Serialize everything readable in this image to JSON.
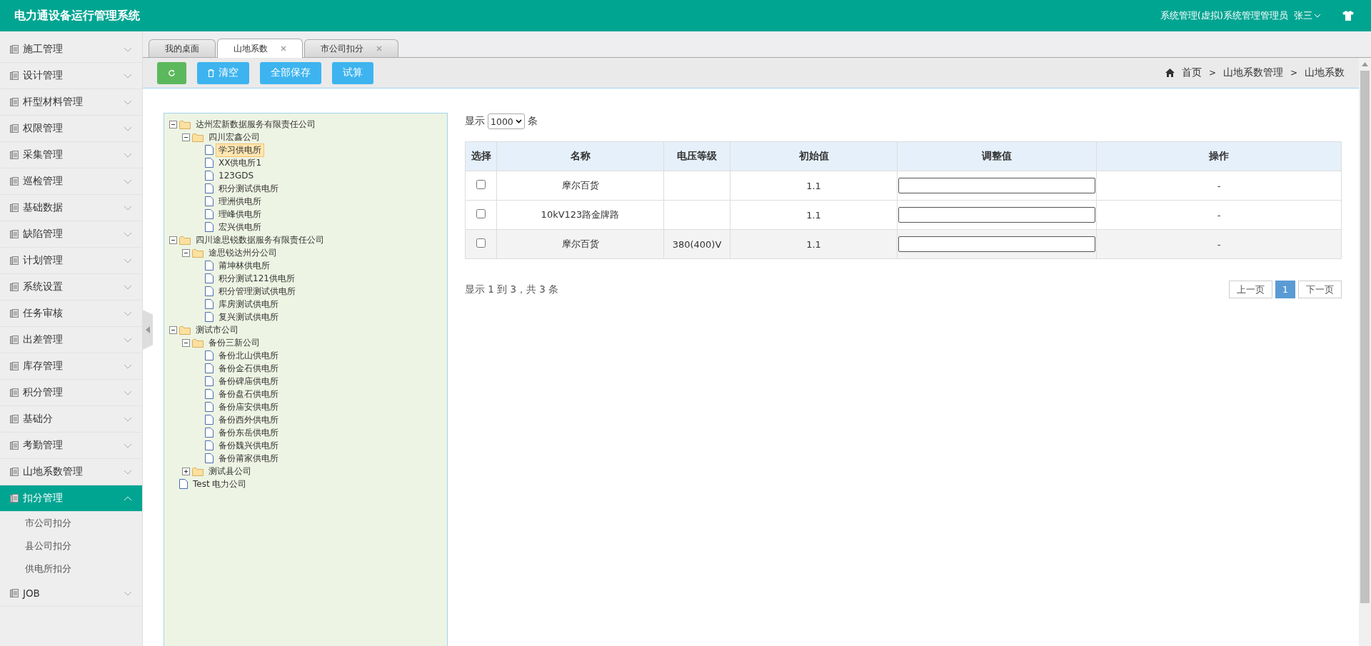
{
  "header": {
    "title": "电力通设备运行管理系统",
    "role": "系统管理(虚拟)系统管理管理员",
    "user": "张三"
  },
  "sidebar": {
    "items": [
      {
        "label": "施工管理",
        "expanded": false,
        "selected": false
      },
      {
        "label": "设计管理",
        "expanded": false,
        "selected": false
      },
      {
        "label": "杆型材料管理",
        "expanded": false,
        "selected": false
      },
      {
        "label": "权限管理",
        "expanded": false,
        "selected": false
      },
      {
        "label": "采集管理",
        "expanded": false,
        "selected": false
      },
      {
        "label": "巡检管理",
        "expanded": false,
        "selected": false
      },
      {
        "label": "基础数据",
        "expanded": false,
        "selected": false
      },
      {
        "label": "缺陷管理",
        "expanded": false,
        "selected": false
      },
      {
        "label": "计划管理",
        "expanded": false,
        "selected": false
      },
      {
        "label": "系统设置",
        "expanded": false,
        "selected": false
      },
      {
        "label": "任务审核",
        "expanded": false,
        "selected": false
      },
      {
        "label": "出差管理",
        "expanded": false,
        "selected": false
      },
      {
        "label": "库存管理",
        "expanded": false,
        "selected": false
      },
      {
        "label": "积分管理",
        "expanded": false,
        "selected": false
      },
      {
        "label": "基础分",
        "expanded": false,
        "selected": false
      },
      {
        "label": "考勤管理",
        "expanded": false,
        "selected": false
      },
      {
        "label": "山地系数管理",
        "expanded": false,
        "selected": false
      },
      {
        "label": "扣分管理",
        "expanded": true,
        "selected": true,
        "children": [
          "市公司扣分",
          "县公司扣分",
          "供电所扣分"
        ]
      },
      {
        "label": "JOB",
        "expanded": false,
        "selected": false
      }
    ]
  },
  "tabs": [
    {
      "label": "我的桌面",
      "selected": false,
      "closable": false
    },
    {
      "label": "山地系数",
      "selected": true,
      "closable": true
    },
    {
      "label": "市公司扣分",
      "selected": false,
      "closable": true
    }
  ],
  "toolbar": [
    {
      "kind": "refresh"
    },
    {
      "kind": "clear",
      "label": "清空"
    },
    {
      "kind": "text",
      "label": "全部保存"
    },
    {
      "kind": "text",
      "label": "试算"
    }
  ],
  "breadcrumb": {
    "items": [
      "首页",
      "山地系数管理",
      "山地系数"
    ],
    "separator": ">"
  },
  "tree": [
    {
      "label": "达州宏新数据服务有限责任公司",
      "kind": "folder",
      "expanded": true,
      "selected": false,
      "children": [
        {
          "label": "四川宏鑫公司",
          "kind": "folder",
          "expanded": true,
          "selected": false,
          "children": [
            {
              "label": "学习供电所",
              "kind": "file",
              "selected": true
            },
            {
              "label": "XX供电所1",
              "kind": "file",
              "selected": false
            },
            {
              "label": "123GDS",
              "kind": "file",
              "selected": false
            },
            {
              "label": "积分测试供电所",
              "kind": "file",
              "selected": false
            },
            {
              "label": "理洲供电所",
              "kind": "file",
              "selected": false
            },
            {
              "label": "理峰供电所",
              "kind": "file",
              "selected": false
            },
            {
              "label": "宏兴供电所",
              "kind": "file",
              "selected": false
            }
          ]
        }
      ]
    },
    {
      "label": "四川途思锐数据服务有限责任公司",
      "kind": "folder",
      "expanded": true,
      "selected": false,
      "children": [
        {
          "label": "途思锐达州分公司",
          "kind": "folder",
          "expanded": true,
          "selected": false,
          "children": [
            {
              "label": "莆坤林供电所",
              "kind": "file",
              "selected": false
            },
            {
              "label": "积分测试121供电所",
              "kind": "file",
              "selected": false
            },
            {
              "label": "积分管理测试供电所",
              "kind": "file",
              "selected": false
            },
            {
              "label": "库房测试供电所",
              "kind": "file",
              "selected": false
            },
            {
              "label": "复兴测试供电所",
              "kind": "file",
              "selected": false
            }
          ]
        }
      ]
    },
    {
      "label": "测试市公司",
      "kind": "folder",
      "expanded": true,
      "selected": false,
      "children": [
        {
          "label": "备份三新公司",
          "kind": "folder",
          "expanded": true,
          "selected": false,
          "children": [
            {
              "label": "备份北山供电所",
              "kind": "file",
              "selected": false
            },
            {
              "label": "备份金石供电所",
              "kind": "file",
              "selected": false
            },
            {
              "label": "备份碑庙供电所",
              "kind": "file",
              "selected": false
            },
            {
              "label": "备份盘石供电所",
              "kind": "file",
              "selected": false
            },
            {
              "label": "备份庙安供电所",
              "kind": "file",
              "selected": false
            },
            {
              "label": "备份西外供电所",
              "kind": "file",
              "selected": false
            },
            {
              "label": "备份东岳供电所",
              "kind": "file",
              "selected": false
            },
            {
              "label": "备份魏兴供电所",
              "kind": "file",
              "selected": false
            },
            {
              "label": "备份莆家供电所",
              "kind": "file",
              "selected": false
            }
          ]
        },
        {
          "label": "测试县公司",
          "kind": "folder",
          "expanded": false,
          "selected": false
        }
      ]
    },
    {
      "label": "Test 电力公司",
      "kind": "file",
      "selected": false
    }
  ],
  "page_size": {
    "prefix": "显示",
    "value": "1000",
    "suffix": "条"
  },
  "table": {
    "columns": [
      "选择",
      "名称",
      "电压等级",
      "初始值",
      "调整值",
      "操作"
    ],
    "rows": [
      {
        "checked": false,
        "highlighted": false,
        "name": "摩尔百货",
        "voltage": "",
        "initial": "1.1",
        "action": "-"
      },
      {
        "checked": false,
        "highlighted": false,
        "name": "10kV123路金牌路",
        "voltage": "",
        "initial": "1.1",
        "action": "-"
      },
      {
        "checked": false,
        "highlighted": true,
        "name": "摩尔百货",
        "voltage": "380(400)V",
        "initial": "1.1",
        "action": "-"
      }
    ]
  },
  "summary": "显示 1 到 3，共 3 条",
  "pagination": [
    {
      "label": "上一页",
      "selected": false
    },
    {
      "label": "1",
      "selected": true
    },
    {
      "label": "下一页",
      "selected": false
    }
  ]
}
